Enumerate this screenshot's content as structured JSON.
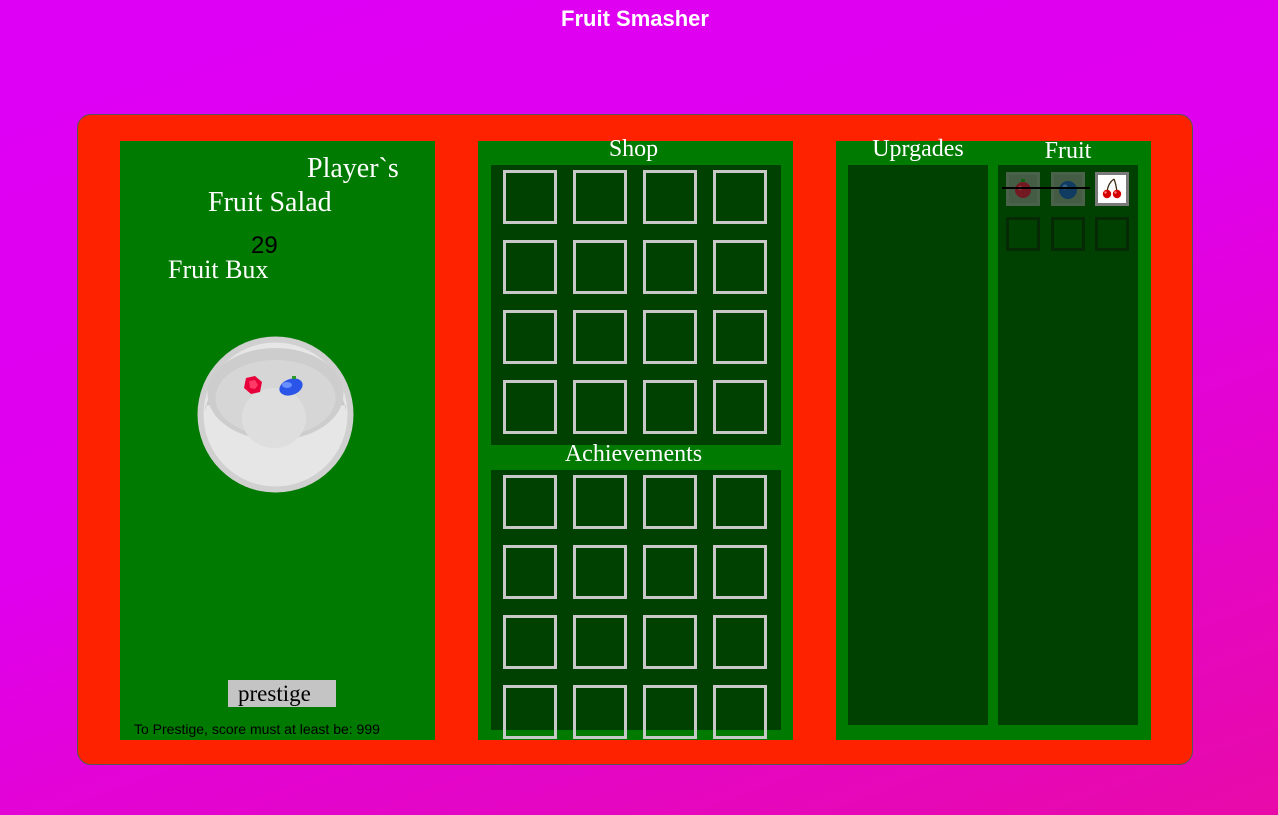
{
  "title": "Fruit Smasher",
  "left": {
    "players_label": "Player`s",
    "salad_label": "Fruit Salad",
    "score": "29",
    "currency_label": "Fruit Bux",
    "prestige_button": "prestige",
    "prestige_note": "To Prestige, score must at least be: 999"
  },
  "shop": {
    "title": "Shop"
  },
  "achievements": {
    "title": "Achievements"
  },
  "upgrades": {
    "title": "Uprgades"
  },
  "fruit": {
    "title": "Fruit",
    "slots": [
      {
        "fruit": "raspberry",
        "state": "locked"
      },
      {
        "fruit": "blueberry",
        "state": "locked"
      },
      {
        "fruit": "cherry",
        "state": "unlocked"
      },
      {
        "state": "empty"
      },
      {
        "state": "empty"
      },
      {
        "state": "empty"
      }
    ]
  },
  "colors": {
    "background": "#e000ee",
    "frame": "#ff2200",
    "panel": "#007a00",
    "inner_panel": "#004000",
    "slot_border": "#c8c8c8"
  }
}
